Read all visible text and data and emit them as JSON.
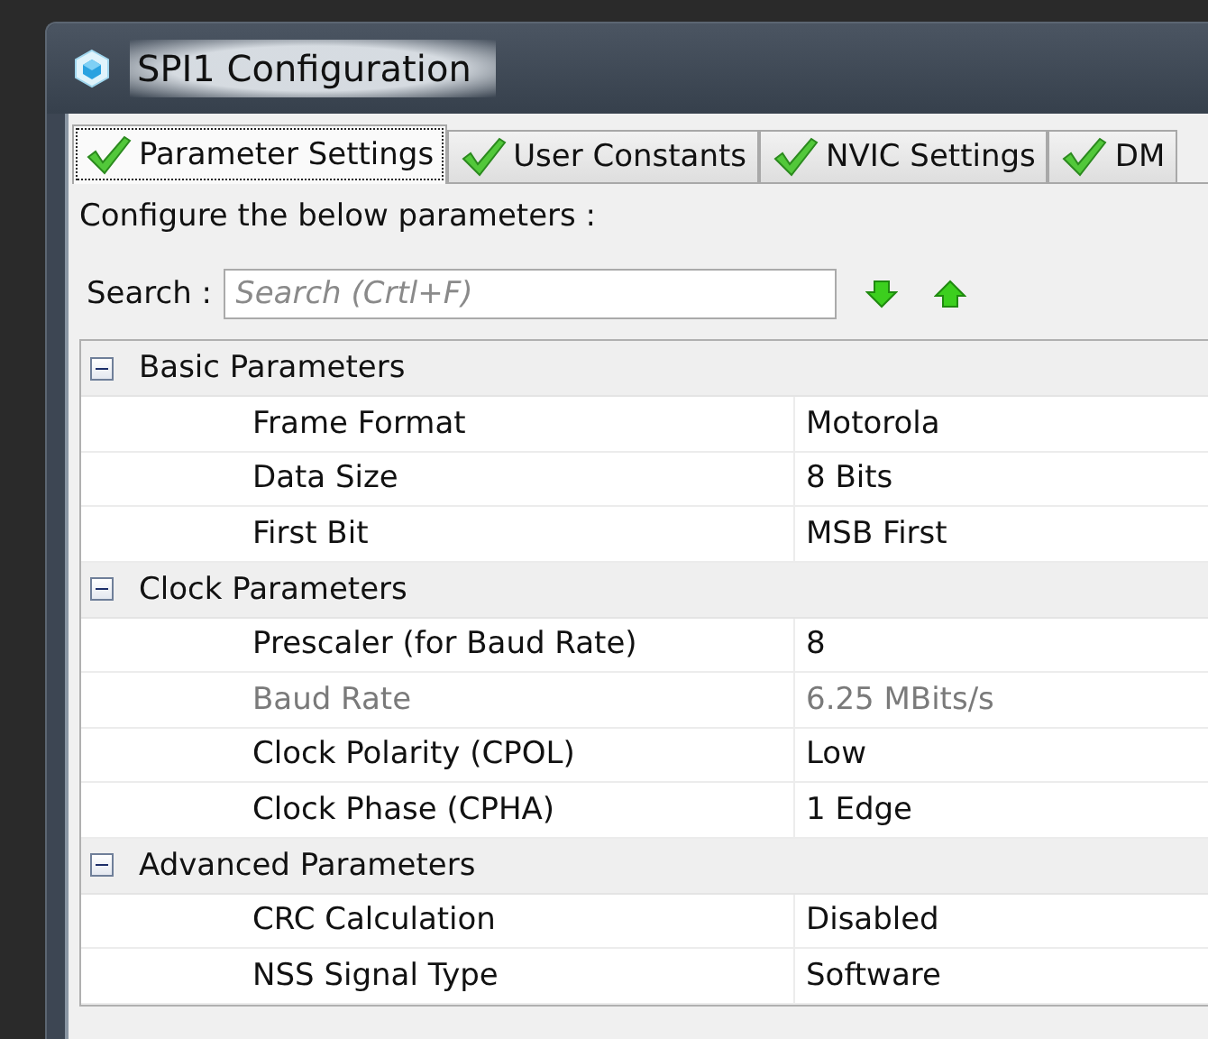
{
  "window": {
    "title": "SPI1 Configuration"
  },
  "tabs": [
    {
      "label": "Parameter Settings",
      "selected": true,
      "valid": true
    },
    {
      "label": "User Constants",
      "selected": false,
      "valid": true
    },
    {
      "label": "NVIC Settings",
      "selected": false,
      "valid": true
    },
    {
      "label": "DM",
      "selected": false,
      "valid": true
    }
  ],
  "instruction": "Configure the below parameters :",
  "search": {
    "label": "Search :",
    "placeholder": "Search (Crtl+F)"
  },
  "groups": [
    {
      "name": "Basic Parameters",
      "expanded": true,
      "children": [
        {
          "name": "Frame Format",
          "value": "Motorola",
          "disabled": false
        },
        {
          "name": "Data Size",
          "value": "8 Bits",
          "disabled": false
        },
        {
          "name": "First Bit",
          "value": "MSB First",
          "disabled": false
        }
      ]
    },
    {
      "name": "Clock Parameters",
      "expanded": true,
      "children": [
        {
          "name": "Prescaler (for Baud Rate)",
          "value": "8",
          "disabled": false
        },
        {
          "name": "Baud Rate",
          "value": "6.25 MBits/s",
          "disabled": true
        },
        {
          "name": "Clock Polarity (CPOL)",
          "value": "Low",
          "disabled": false
        },
        {
          "name": "Clock Phase (CPHA)",
          "value": "1 Edge",
          "disabled": false
        }
      ]
    },
    {
      "name": "Advanced Parameters",
      "expanded": true,
      "children": [
        {
          "name": "CRC Calculation",
          "value": "Disabled",
          "disabled": false
        },
        {
          "name": "NSS Signal Type",
          "value": "Software",
          "disabled": false
        }
      ]
    }
  ]
}
